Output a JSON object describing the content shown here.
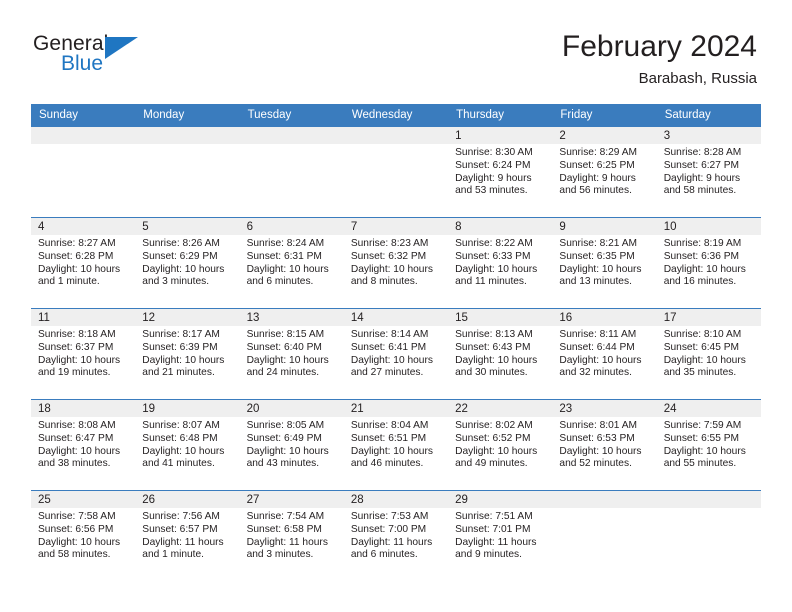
{
  "brand": {
    "word1": "General",
    "word2": "Blue",
    "accent_color": "#1f76c2",
    "triangle_icon": "brand-triangle-icon"
  },
  "header": {
    "title": "February 2024",
    "subtitle": "Barabash, Russia"
  },
  "theme": {
    "header_band": "#3a7cbe",
    "daynum_strip": "#efefef",
    "text": "#231f20"
  },
  "calendar": {
    "weekday_headers": [
      "Sunday",
      "Monday",
      "Tuesday",
      "Wednesday",
      "Thursday",
      "Friday",
      "Saturday"
    ],
    "labels": {
      "sunrise_prefix": "Sunrise:",
      "sunset_prefix": "Sunset:",
      "daylight_prefix": "Daylight:"
    },
    "weeks": [
      [
        {
          "day": ""
        },
        {
          "day": ""
        },
        {
          "day": ""
        },
        {
          "day": ""
        },
        {
          "day": "1",
          "sunrise": "Sunrise: 8:30 AM",
          "sunset": "Sunset: 6:24 PM",
          "daylight": "Daylight: 9 hours and 53 minutes."
        },
        {
          "day": "2",
          "sunrise": "Sunrise: 8:29 AM",
          "sunset": "Sunset: 6:25 PM",
          "daylight": "Daylight: 9 hours and 56 minutes."
        },
        {
          "day": "3",
          "sunrise": "Sunrise: 8:28 AM",
          "sunset": "Sunset: 6:27 PM",
          "daylight": "Daylight: 9 hours and 58 minutes."
        }
      ],
      [
        {
          "day": "4",
          "sunrise": "Sunrise: 8:27 AM",
          "sunset": "Sunset: 6:28 PM",
          "daylight": "Daylight: 10 hours and 1 minute."
        },
        {
          "day": "5",
          "sunrise": "Sunrise: 8:26 AM",
          "sunset": "Sunset: 6:29 PM",
          "daylight": "Daylight: 10 hours and 3 minutes."
        },
        {
          "day": "6",
          "sunrise": "Sunrise: 8:24 AM",
          "sunset": "Sunset: 6:31 PM",
          "daylight": "Daylight: 10 hours and 6 minutes."
        },
        {
          "day": "7",
          "sunrise": "Sunrise: 8:23 AM",
          "sunset": "Sunset: 6:32 PM",
          "daylight": "Daylight: 10 hours and 8 minutes."
        },
        {
          "day": "8",
          "sunrise": "Sunrise: 8:22 AM",
          "sunset": "Sunset: 6:33 PM",
          "daylight": "Daylight: 10 hours and 11 minutes."
        },
        {
          "day": "9",
          "sunrise": "Sunrise: 8:21 AM",
          "sunset": "Sunset: 6:35 PM",
          "daylight": "Daylight: 10 hours and 13 minutes."
        },
        {
          "day": "10",
          "sunrise": "Sunrise: 8:19 AM",
          "sunset": "Sunset: 6:36 PM",
          "daylight": "Daylight: 10 hours and 16 minutes."
        }
      ],
      [
        {
          "day": "11",
          "sunrise": "Sunrise: 8:18 AM",
          "sunset": "Sunset: 6:37 PM",
          "daylight": "Daylight: 10 hours and 19 minutes."
        },
        {
          "day": "12",
          "sunrise": "Sunrise: 8:17 AM",
          "sunset": "Sunset: 6:39 PM",
          "daylight": "Daylight: 10 hours and 21 minutes."
        },
        {
          "day": "13",
          "sunrise": "Sunrise: 8:15 AM",
          "sunset": "Sunset: 6:40 PM",
          "daylight": "Daylight: 10 hours and 24 minutes."
        },
        {
          "day": "14",
          "sunrise": "Sunrise: 8:14 AM",
          "sunset": "Sunset: 6:41 PM",
          "daylight": "Daylight: 10 hours and 27 minutes."
        },
        {
          "day": "15",
          "sunrise": "Sunrise: 8:13 AM",
          "sunset": "Sunset: 6:43 PM",
          "daylight": "Daylight: 10 hours and 30 minutes."
        },
        {
          "day": "16",
          "sunrise": "Sunrise: 8:11 AM",
          "sunset": "Sunset: 6:44 PM",
          "daylight": "Daylight: 10 hours and 32 minutes."
        },
        {
          "day": "17",
          "sunrise": "Sunrise: 8:10 AM",
          "sunset": "Sunset: 6:45 PM",
          "daylight": "Daylight: 10 hours and 35 minutes."
        }
      ],
      [
        {
          "day": "18",
          "sunrise": "Sunrise: 8:08 AM",
          "sunset": "Sunset: 6:47 PM",
          "daylight": "Daylight: 10 hours and 38 minutes."
        },
        {
          "day": "19",
          "sunrise": "Sunrise: 8:07 AM",
          "sunset": "Sunset: 6:48 PM",
          "daylight": "Daylight: 10 hours and 41 minutes."
        },
        {
          "day": "20",
          "sunrise": "Sunrise: 8:05 AM",
          "sunset": "Sunset: 6:49 PM",
          "daylight": "Daylight: 10 hours and 43 minutes."
        },
        {
          "day": "21",
          "sunrise": "Sunrise: 8:04 AM",
          "sunset": "Sunset: 6:51 PM",
          "daylight": "Daylight: 10 hours and 46 minutes."
        },
        {
          "day": "22",
          "sunrise": "Sunrise: 8:02 AM",
          "sunset": "Sunset: 6:52 PM",
          "daylight": "Daylight: 10 hours and 49 minutes."
        },
        {
          "day": "23",
          "sunrise": "Sunrise: 8:01 AM",
          "sunset": "Sunset: 6:53 PM",
          "daylight": "Daylight: 10 hours and 52 minutes."
        },
        {
          "day": "24",
          "sunrise": "Sunrise: 7:59 AM",
          "sunset": "Sunset: 6:55 PM",
          "daylight": "Daylight: 10 hours and 55 minutes."
        }
      ],
      [
        {
          "day": "25",
          "sunrise": "Sunrise: 7:58 AM",
          "sunset": "Sunset: 6:56 PM",
          "daylight": "Daylight: 10 hours and 58 minutes."
        },
        {
          "day": "26",
          "sunrise": "Sunrise: 7:56 AM",
          "sunset": "Sunset: 6:57 PM",
          "daylight": "Daylight: 11 hours and 1 minute."
        },
        {
          "day": "27",
          "sunrise": "Sunrise: 7:54 AM",
          "sunset": "Sunset: 6:58 PM",
          "daylight": "Daylight: 11 hours and 3 minutes."
        },
        {
          "day": "28",
          "sunrise": "Sunrise: 7:53 AM",
          "sunset": "Sunset: 7:00 PM",
          "daylight": "Daylight: 11 hours and 6 minutes."
        },
        {
          "day": "29",
          "sunrise": "Sunrise: 7:51 AM",
          "sunset": "Sunset: 7:01 PM",
          "daylight": "Daylight: 11 hours and 9 minutes."
        },
        {
          "day": ""
        },
        {
          "day": ""
        }
      ]
    ]
  }
}
